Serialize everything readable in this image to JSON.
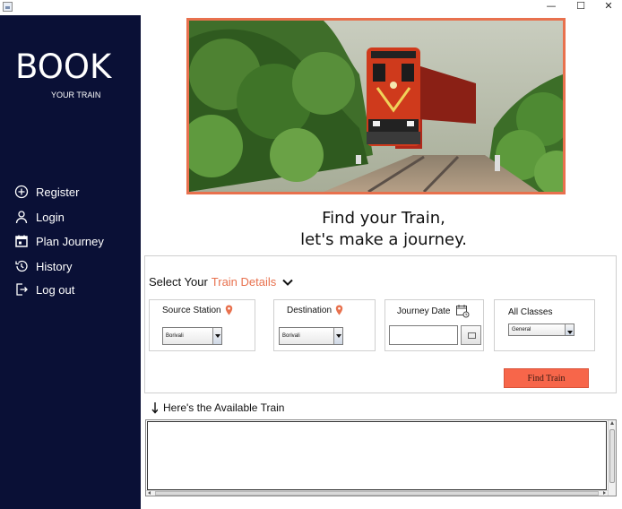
{
  "window": {
    "controls": {
      "minimize": "—",
      "maximize": "☐",
      "close": "✕"
    }
  },
  "sidebar": {
    "brand": "BOOK",
    "brand_sub": "YOUR TRAIN",
    "background": "#0a1036",
    "items": [
      {
        "label": "Register",
        "icon": "plus-circle-icon"
      },
      {
        "label": "Login",
        "icon": "user-icon"
      },
      {
        "label": "Plan Journey",
        "icon": "calendar-icon"
      },
      {
        "label": "History",
        "icon": "history-icon"
      },
      {
        "label": "Log out",
        "icon": "logout-icon"
      }
    ]
  },
  "hero": {
    "icon": "train-photo",
    "border_color": "#e8714e"
  },
  "tagline": {
    "line1": "Find your Train,",
    "line2": "let's make a journey."
  },
  "details": {
    "title_prefix": "Select Your",
    "title_highlight": "Train Details",
    "highlight_color": "#e8714e",
    "source": {
      "label": "Source Station",
      "value": "Borivali"
    },
    "destination": {
      "label": "Destination",
      "value": "Borivali"
    },
    "journey_date": {
      "label": "Journey Date",
      "value": ""
    },
    "class": {
      "label": "All Classes",
      "value": "General"
    },
    "find_button": "Find Train",
    "find_button_color": "#f7664a"
  },
  "results": {
    "title": "Here's the Available Train"
  }
}
